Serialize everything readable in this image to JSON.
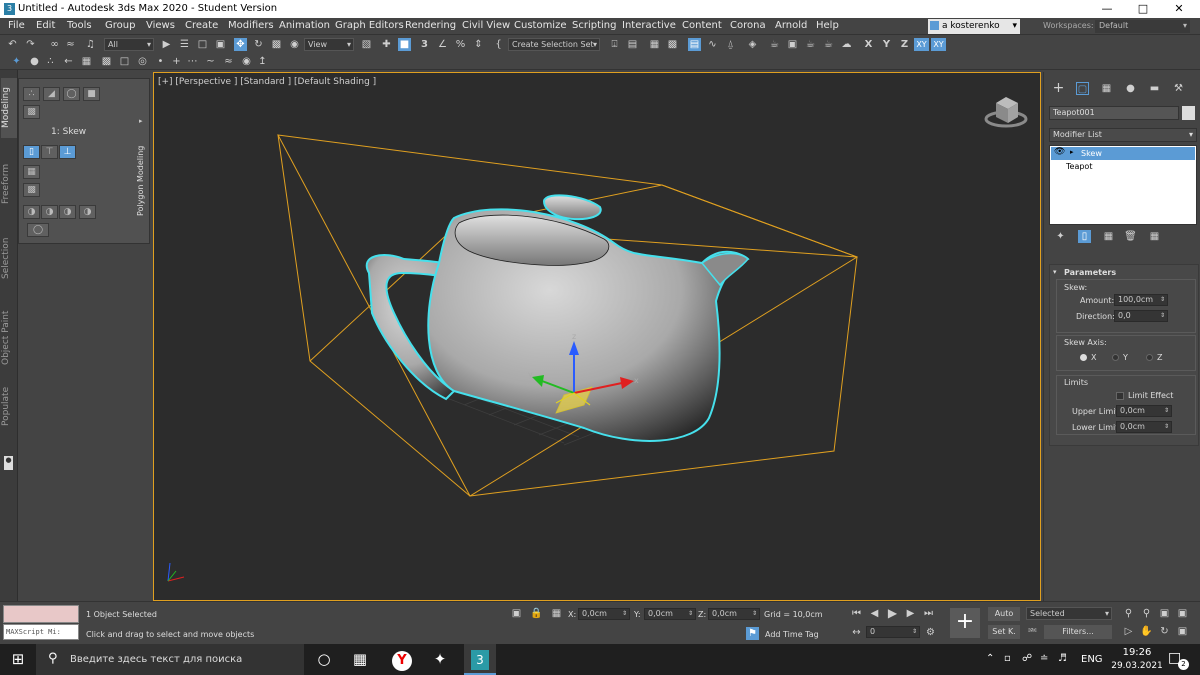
{
  "window": {
    "title": "Untitled - Autodesk 3ds Max 2020 - Student Version",
    "app_icon": "3"
  },
  "menu": [
    "File",
    "Edit",
    "Tools",
    "Group",
    "Views",
    "Create",
    "Modifiers",
    "Animation",
    "Graph Editors",
    "Rendering",
    "Civil View",
    "Customize",
    "Scripting",
    "Interactive",
    "Content",
    "Corona",
    "Arnold",
    "Help"
  ],
  "user": "a kosterenko",
  "workspaces": {
    "label": "Workspaces:",
    "value": "Default"
  },
  "toolbar": {
    "filter": "All",
    "ref_coord": "View",
    "selection_set": "Create Selection Set",
    "axes": [
      "X",
      "Y",
      "Z",
      "XY",
      "XY"
    ],
    "snap_label": "3",
    "angle_snap": "%"
  },
  "ribbon": {
    "tabs": [
      "Modeling",
      "Freeform",
      "Selection",
      "Object Paint",
      "Populate"
    ],
    "panel_label": "Polygon Modeling",
    "level": "1: Skew"
  },
  "viewport": {
    "label": "[+] [Perspective ] [Standard ] [Default Shading ]",
    "gizmo": {
      "x": "x",
      "y": "y",
      "z": "z"
    }
  },
  "command_panel": {
    "object_name": "Teapot001",
    "modifier_list": "Modifier List",
    "stack": [
      "Skew",
      "Teapot"
    ],
    "rollout_title": "Parameters",
    "skew_group": "Skew:",
    "amount_label": "Amount:",
    "amount": "100,0cm",
    "direction_label": "Direction:",
    "direction": "0,0",
    "axis_group": "Skew Axis:",
    "axes": [
      "X",
      "Y",
      "Z"
    ],
    "axis_selected": "X",
    "limits_group": "Limits",
    "limit_effect": "Limit Effect",
    "upper_label": "Upper Limit:",
    "upper": "0,0cm",
    "lower_label": "Lower Limit:",
    "lower": "0,0cm"
  },
  "status": {
    "maxscript": "MAXScript Mi:",
    "selected": "1 Object Selected",
    "prompt": "Click and drag to select and move objects",
    "x_label": "X:",
    "x": "0,0cm",
    "y_label": "Y:",
    "y": "0,0cm",
    "z_label": "Z:",
    "z": "0,0cm",
    "grid": "Grid = 10,0cm",
    "add_time_tag": "Add Time Tag",
    "frame": "0",
    "auto": "Auto",
    "setk": "Set K.",
    "key_filter": "Selected",
    "filters": "Filters..."
  },
  "taskbar": {
    "search": "Введите здесь текст для поиска",
    "lang": "ENG",
    "time": "19:26",
    "date": "29.03.2021",
    "notif": "2"
  },
  "colors": {
    "accent": "#5b9bd5",
    "bbox": "#e0a020",
    "highlight": "#46e0ec",
    "viewport_bg": "#2c2c2c"
  }
}
